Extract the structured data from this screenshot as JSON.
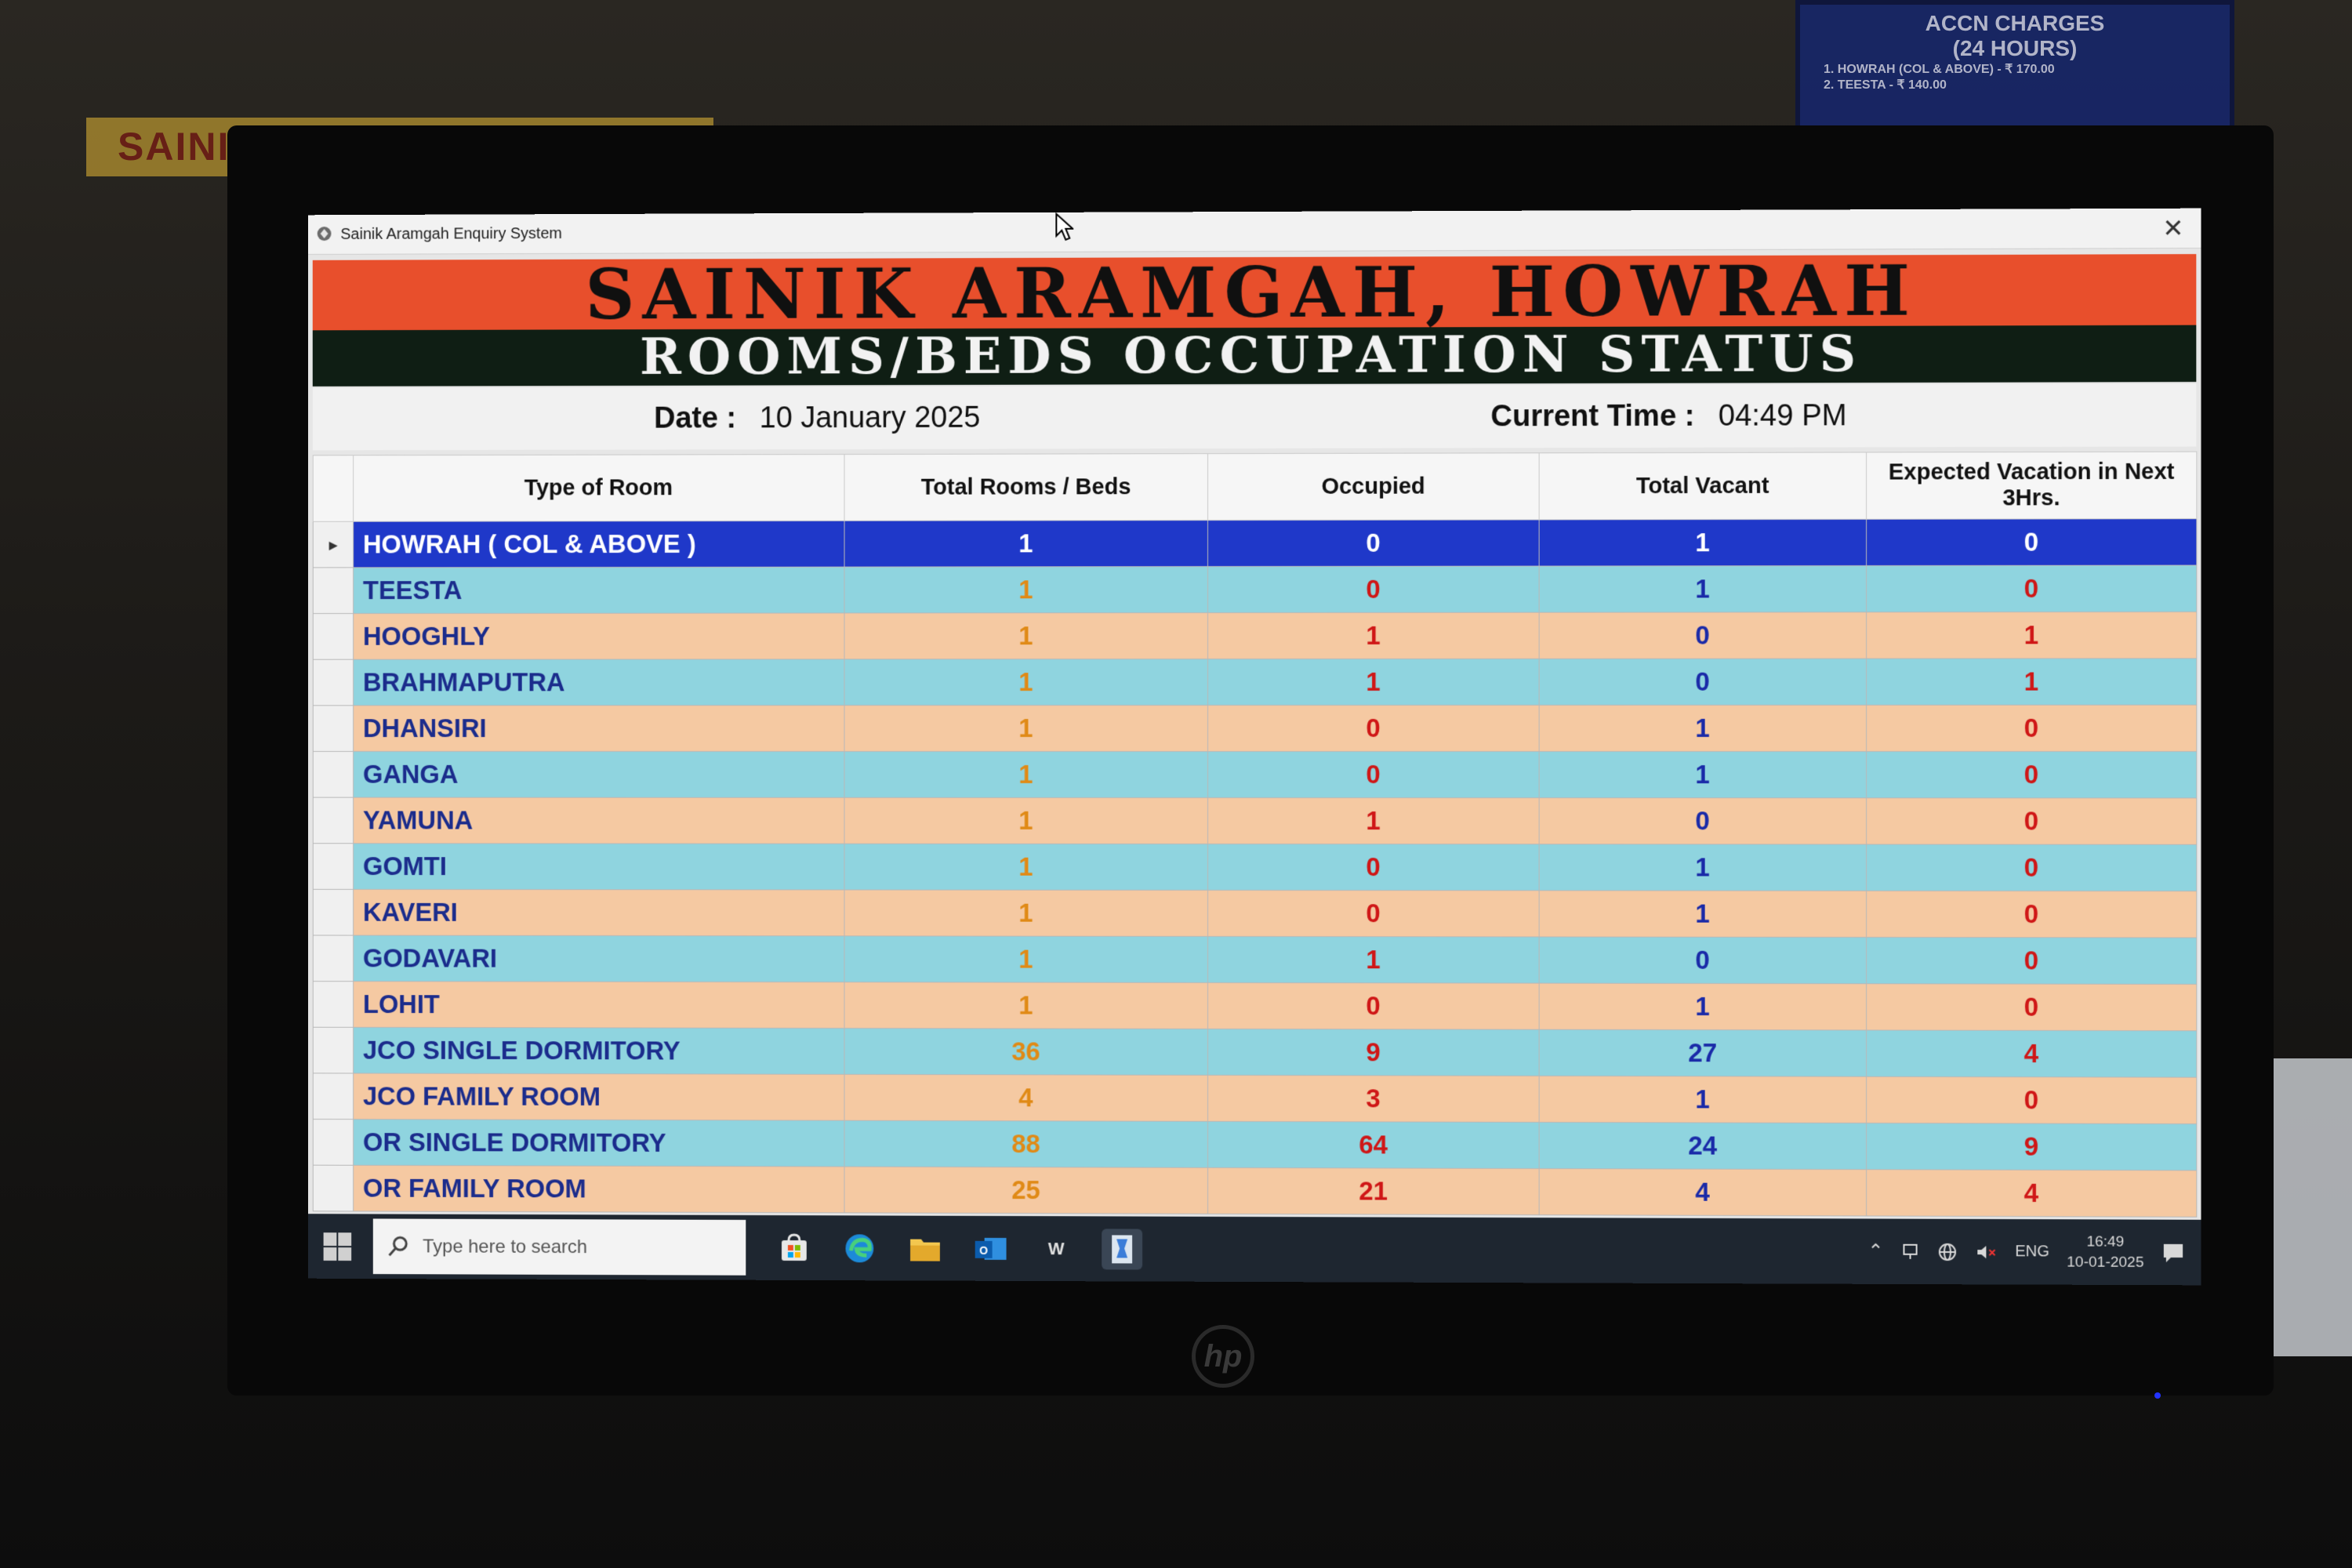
{
  "window": {
    "title": "Sainik Aramgah Enquiry System"
  },
  "header": {
    "title": "SAINIK ARAMGAH, HOWRAH",
    "subtitle": "ROOMS/BEDS OCCUPATION STATUS",
    "date_label": "Date :",
    "date_value": "10 January 2025",
    "time_label": "Current Time :",
    "time_value": "04:49 PM"
  },
  "table": {
    "columns": [
      "Type of Room",
      "Total Rooms / Beds",
      "Occupied",
      "Total Vacant",
      "Expected Vacation in Next 3Hrs."
    ],
    "rows": [
      {
        "room": "HOWRAH ( COL & ABOVE )",
        "total": "1",
        "occupied": "0",
        "vacant": "1",
        "expected": "0"
      },
      {
        "room": "TEESTA",
        "total": "1",
        "occupied": "0",
        "vacant": "1",
        "expected": "0"
      },
      {
        "room": "HOOGHLY",
        "total": "1",
        "occupied": "1",
        "vacant": "0",
        "expected": "1"
      },
      {
        "room": "BRAHMAPUTRA",
        "total": "1",
        "occupied": "1",
        "vacant": "0",
        "expected": "1"
      },
      {
        "room": "DHANSIRI",
        "total": "1",
        "occupied": "0",
        "vacant": "1",
        "expected": "0"
      },
      {
        "room": "GANGA",
        "total": "1",
        "occupied": "0",
        "vacant": "1",
        "expected": "0"
      },
      {
        "room": "YAMUNA",
        "total": "1",
        "occupied": "1",
        "vacant": "0",
        "expected": "0"
      },
      {
        "room": "GOMTI",
        "total": "1",
        "occupied": "0",
        "vacant": "1",
        "expected": "0"
      },
      {
        "room": "KAVERI",
        "total": "1",
        "occupied": "0",
        "vacant": "1",
        "expected": "0"
      },
      {
        "room": "GODAVARI",
        "total": "1",
        "occupied": "1",
        "vacant": "0",
        "expected": "0"
      },
      {
        "room": "LOHIT",
        "total": "1",
        "occupied": "0",
        "vacant": "1",
        "expected": "0"
      },
      {
        "room": "JCO SINGLE DORMITORY",
        "total": "36",
        "occupied": "9",
        "vacant": "27",
        "expected": "4"
      },
      {
        "room": "JCO FAMILY ROOM",
        "total": "4",
        "occupied": "3",
        "vacant": "1",
        "expected": "0"
      },
      {
        "room": "OR SINGLE DORMITORY",
        "total": "88",
        "occupied": "64",
        "vacant": "24",
        "expected": "9"
      },
      {
        "room": "OR FAMILY ROOM",
        "total": "25",
        "occupied": "21",
        "vacant": "4",
        "expected": "4"
      }
    ],
    "selected_row_marker": "▸"
  },
  "taskbar": {
    "search_placeholder": "Type here to search",
    "word_icon_letter": "W",
    "language": "ENG",
    "time": "16:49",
    "date": "10-01-2025"
  },
  "background": {
    "wall_sign": "SAINIK ARAMGAH HOWRAH",
    "notice_title": "ACCN CHARGES",
    "notice_subtitle": "(24 HOURS)",
    "notice_line1": "1.  HOWRAH (COL & ABOVE)   -  ₹ 170.00",
    "notice_line2": "2.  TEESTA   -  ₹ 140.00"
  },
  "monitor": {
    "brand": "hp"
  },
  "colors": {
    "banner_red": "#e84f2c",
    "banner_dark": "#0f1e14",
    "row_cyan": "#8fd4df",
    "row_peach": "#f5c9a2",
    "row_selected": "#1f38c9",
    "total_orange": "#e08a16",
    "occupied_red": "#cf1616",
    "vacant_blue": "#1a2aa8"
  },
  "icons": [
    "app-icon",
    "close-icon",
    "mouse-cursor-icon",
    "windows-start-icon",
    "search-icon",
    "store-icon",
    "edge-icon",
    "file-explorer-icon",
    "outlook-icon",
    "word-icon",
    "app-taskbar-icon",
    "chevron-up-icon",
    "network-icon",
    "globe-icon",
    "volume-muted-icon",
    "notification-icon"
  ]
}
